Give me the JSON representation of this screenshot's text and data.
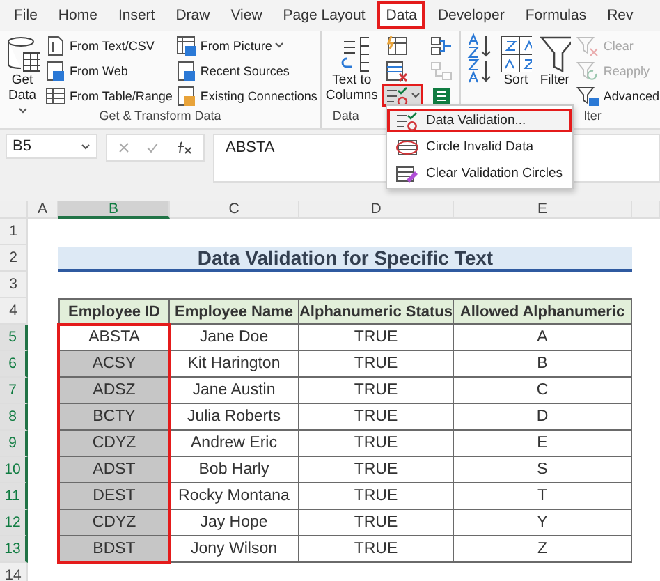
{
  "tabs": [
    {
      "label": "File",
      "selected": false,
      "highlighted": false
    },
    {
      "label": "Home",
      "selected": false,
      "highlighted": false
    },
    {
      "label": "Insert",
      "selected": false,
      "highlighted": false
    },
    {
      "label": "Draw",
      "selected": false,
      "highlighted": false
    },
    {
      "label": "View",
      "selected": false,
      "highlighted": false
    },
    {
      "label": "Page Layout",
      "selected": false,
      "highlighted": false
    },
    {
      "label": "Data",
      "selected": true,
      "highlighted": true
    },
    {
      "label": "Developer",
      "selected": false,
      "highlighted": false
    },
    {
      "label": "Formulas",
      "selected": false,
      "highlighted": false
    },
    {
      "label": "Rev",
      "selected": false,
      "highlighted": false
    }
  ],
  "ribbon": {
    "groups": [
      {
        "label": "Get & Transform Data",
        "columns": [
          [
            {
              "kind": "large",
              "label": "Get Data",
              "dropdown": true
            }
          ],
          [
            {
              "kind": "small",
              "label": "From Text/CSV"
            },
            {
              "kind": "small",
              "label": "From Web"
            },
            {
              "kind": "small",
              "label": "From Table/Range"
            }
          ],
          [
            {
              "kind": "small",
              "label": "From Picture",
              "dropdown": true
            },
            {
              "kind": "small",
              "label": "Recent Sources"
            },
            {
              "kind": "small",
              "label": "Existing Connections"
            }
          ]
        ]
      },
      {
        "label": "Data",
        "columns": [
          [
            {
              "kind": "large",
              "label": "Text to Columns"
            }
          ],
          [
            {
              "kind": "icon"
            },
            {
              "kind": "icon"
            },
            {
              "kind": "icon",
              "dropdown": true,
              "highlighted": true
            }
          ],
          [
            {
              "kind": "icon"
            },
            {
              "kind": "icon",
              "disabled": true
            },
            {
              "kind": "icon"
            }
          ]
        ]
      },
      {
        "label": "lter",
        "columns": [
          [
            {
              "kind": "icon"
            },
            {
              "kind": "icon"
            }
          ],
          [
            {
              "kind": "large",
              "label": "Sort"
            }
          ],
          [
            {
              "kind": "large",
              "label": "Filter"
            }
          ],
          [
            {
              "kind": "small",
              "label": "Clear",
              "disabled": true
            },
            {
              "kind": "small",
              "label": "Reapply",
              "disabled": true
            },
            {
              "kind": "small",
              "label": "Advanced",
              "disabled": false
            }
          ]
        ]
      }
    ]
  },
  "menu": {
    "items": [
      {
        "label": "Data Validation...",
        "highlighted": true
      },
      {
        "label": "Circle Invalid Data",
        "highlighted": false
      },
      {
        "label": "Clear Validation Circles",
        "highlighted": false
      }
    ]
  },
  "formula_bar": {
    "name_box": "B5",
    "value": "ABSTA"
  },
  "sheet": {
    "columns": [
      {
        "label": "A",
        "selected": false
      },
      {
        "label": "B",
        "selected": true
      },
      {
        "label": "C",
        "selected": false
      },
      {
        "label": "D",
        "selected": false
      },
      {
        "label": "E",
        "selected": false
      }
    ],
    "row_numbers": [
      {
        "label": "1",
        "selected": false
      },
      {
        "label": "2",
        "selected": false
      },
      {
        "label": "3",
        "selected": false
      },
      {
        "label": "4",
        "selected": false
      },
      {
        "label": "5",
        "selected": true
      },
      {
        "label": "6",
        "selected": true
      },
      {
        "label": "7",
        "selected": true
      },
      {
        "label": "8",
        "selected": true
      },
      {
        "label": "9",
        "selected": true
      },
      {
        "label": "10",
        "selected": true
      },
      {
        "label": "11",
        "selected": true
      },
      {
        "label": "12",
        "selected": true
      },
      {
        "label": "13",
        "selected": true
      },
      {
        "label": "14",
        "selected": false
      }
    ],
    "title": "Data Validation for Specific Text",
    "table": {
      "id_column_highlighted": true,
      "headers": [
        "Employee ID",
        "Employee Name",
        "Alphanumeric Status",
        "Allowed Alphanumeric"
      ],
      "rows": [
        {
          "id": "ABSTA",
          "name": "Jane Doe",
          "status": "TRUE",
          "allowed": "A",
          "selected": false
        },
        {
          "id": "ACSY",
          "name": "Kit Harington",
          "status": "TRUE",
          "allowed": "B",
          "selected": true
        },
        {
          "id": "ADSZ",
          "name": "Jane Austin",
          "status": "TRUE",
          "allowed": "C",
          "selected": true
        },
        {
          "id": "BCTY",
          "name": "Julia Roberts",
          "status": "TRUE",
          "allowed": "D",
          "selected": true
        },
        {
          "id": "CDYZ",
          "name": "Andrew Eric",
          "status": "TRUE",
          "allowed": "E",
          "selected": true
        },
        {
          "id": "ADST",
          "name": "Bob Harly",
          "status": "TRUE",
          "allowed": "S",
          "selected": true
        },
        {
          "id": "DEST",
          "name": "Rocky Montana",
          "status": "TRUE",
          "allowed": "T",
          "selected": true
        },
        {
          "id": "CDYZ",
          "name": "Jay Hope",
          "status": "TRUE",
          "allowed": "Y",
          "selected": true
        },
        {
          "id": "BDST",
          "name": "Jony Wilson",
          "status": "TRUE",
          "allowed": "Z",
          "selected": true
        }
      ]
    }
  }
}
